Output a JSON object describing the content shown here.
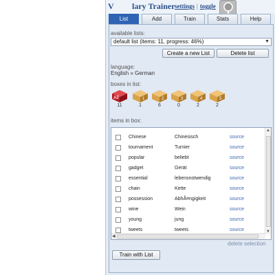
{
  "window": {
    "title_first_letter": "V",
    "title_rest": "lary Trainer",
    "link_settings": "settings",
    "separator": "|",
    "link_toggle": "toggle"
  },
  "tabs": [
    {
      "label": "List",
      "active": true
    },
    {
      "label": "Add",
      "active": false
    },
    {
      "label": "Train",
      "active": false
    },
    {
      "label": "Stats",
      "active": false
    },
    {
      "label": "Help",
      "active": false
    }
  ],
  "lists": {
    "label": "available lists:",
    "selected": "default list (items: 11, progress: 46%)",
    "new_button": "Create a new List",
    "delete_button": "Delete list"
  },
  "language": {
    "label": "language:",
    "value": "English » German"
  },
  "boxes": {
    "label": "boxes in list:",
    "items": [
      {
        "name": "All",
        "count": "11",
        "color": "#b81c24"
      },
      {
        "name": "1",
        "count": "1",
        "color": "#d9a34a"
      },
      {
        "name": "2",
        "count": "6",
        "color": "#d9a34a"
      },
      {
        "name": "3",
        "count": "0",
        "color": "#d9a34a"
      },
      {
        "name": "4",
        "count": "2",
        "color": "#d9a34a"
      },
      {
        "name": "5",
        "count": "2",
        "color": "#d9a34a"
      }
    ]
  },
  "items": {
    "label": "items in box:",
    "rows": [
      {
        "en": "Chinese",
        "de": "Chinesisch",
        "src": "source"
      },
      {
        "en": "tournament",
        "de": "Turnier",
        "src": "source"
      },
      {
        "en": "popular",
        "de": "beliebt",
        "src": "source"
      },
      {
        "en": "gadget",
        "de": "Gerät",
        "src": "source"
      },
      {
        "en": "essential",
        "de": "lebensnotwendig",
        "src": "source"
      },
      {
        "en": "chain",
        "de": "Kette",
        "src": "source"
      },
      {
        "en": "possession",
        "de": "AbhÃ¤ngigkeit",
        "src": "source"
      },
      {
        "en": "wine",
        "de": "Wein",
        "src": "source"
      },
      {
        "en": "young",
        "de": "jung",
        "src": "source"
      },
      {
        "en": "tweets",
        "de": "tweets",
        "src": "source"
      }
    ],
    "delete_selection": "delete selection",
    "train_button": "Train with List"
  },
  "colors": {
    "accent": "#2f63b3",
    "link": "#3c68b0",
    "panel_bg": "#e1e9f4"
  }
}
